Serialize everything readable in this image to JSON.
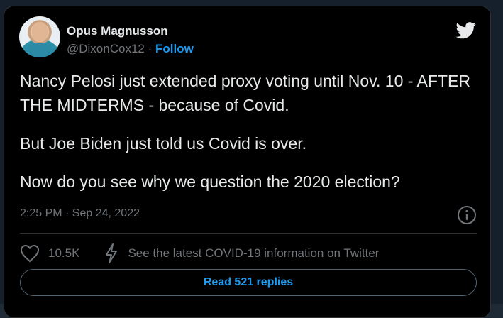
{
  "author": {
    "name": "Opus Magnusson",
    "handle": "@DixonCox12",
    "separator": " · ",
    "follow_label": "Follow"
  },
  "tweet": {
    "paragraphs": [
      "Nancy Pelosi just extended proxy voting until Nov. 10 - AFTER THE MIDTERMS - because of Covid.",
      "But Joe Biden just told us Covid is over.",
      "Now do you see why we question the 2020 election?"
    ],
    "timestamp": "2:25 PM · Sep 24, 2022"
  },
  "actions": {
    "likes": "10.5K",
    "covid_info": "See the latest COVID-19 information on Twitter"
  },
  "replies_button": "Read 521 replies",
  "colors": {
    "accent": "#1d9bf0",
    "text": "#e7e9ea",
    "muted": "#71767b",
    "background": "#000000"
  },
  "icons": {
    "brand": "twitter-bird-icon",
    "info": "info-icon",
    "like": "heart-icon",
    "covid": "lightning-bolt-icon"
  }
}
